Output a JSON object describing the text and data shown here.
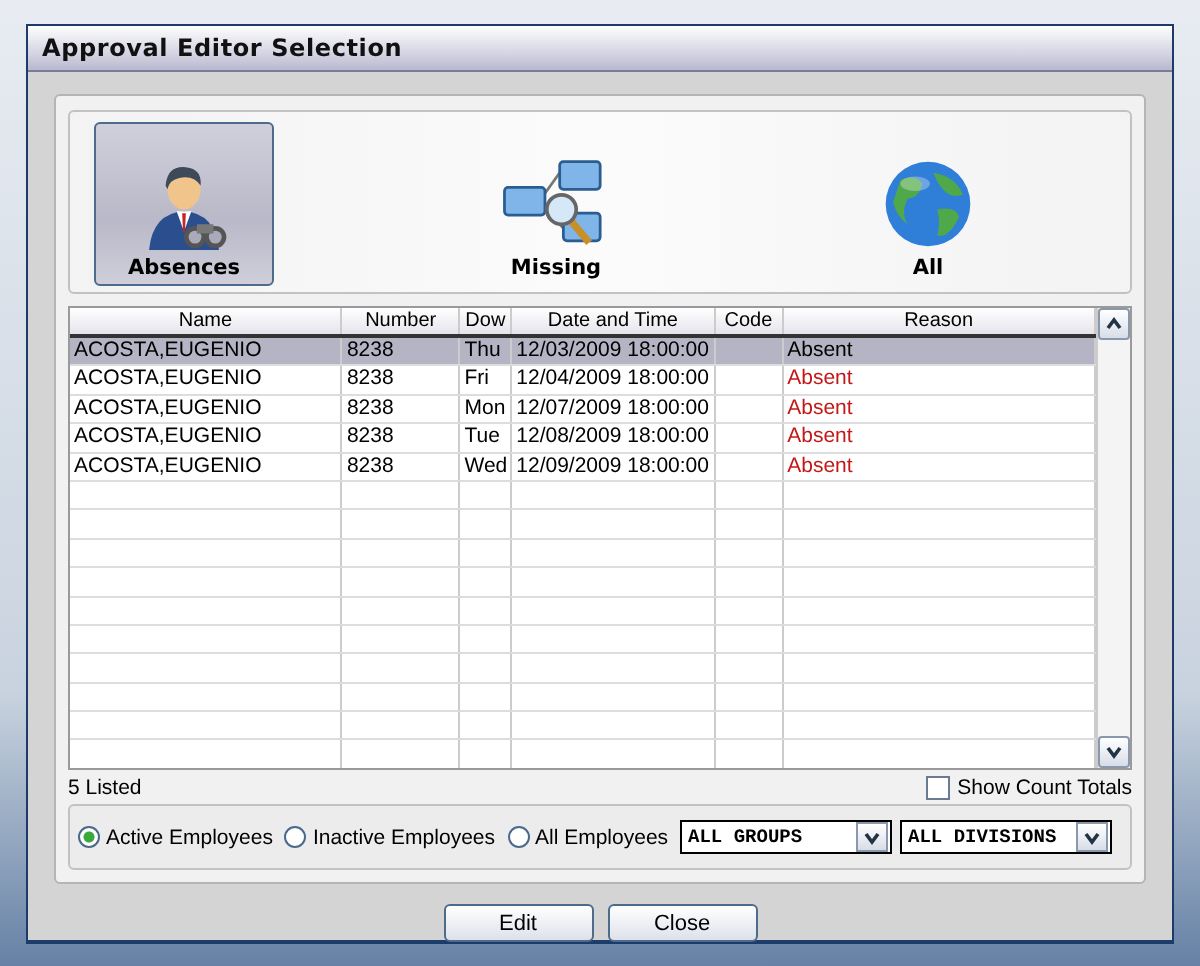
{
  "window": {
    "title": "Approval Editor Selection"
  },
  "modes": [
    {
      "label": "Absences",
      "selected": true
    },
    {
      "label": "Missing",
      "selected": false
    },
    {
      "label": "All",
      "selected": false
    }
  ],
  "table": {
    "columns": [
      "Name",
      "Number",
      "Dow",
      "Date and Time",
      "Code",
      "Reason"
    ],
    "rows": [
      {
        "cells": [
          "ACOSTA,EUGENIO",
          "8238",
          "Thu",
          "12/03/2009 18:00:00",
          "",
          "Absent"
        ],
        "selected": true
      },
      {
        "cells": [
          "ACOSTA,EUGENIO",
          "8238",
          "Fri",
          "12/04/2009 18:00:00",
          "",
          "Absent"
        ],
        "selected": false
      },
      {
        "cells": [
          "ACOSTA,EUGENIO",
          "8238",
          "Mon",
          "12/07/2009 18:00:00",
          "",
          "Absent"
        ],
        "selected": false
      },
      {
        "cells": [
          "ACOSTA,EUGENIO",
          "8238",
          "Tue",
          "12/08/2009 18:00:00",
          "",
          "Absent"
        ],
        "selected": false
      },
      {
        "cells": [
          "ACOSTA,EUGENIO",
          "8238",
          "Wed",
          "12/09/2009 18:00:00",
          "",
          "Absent"
        ],
        "selected": false
      }
    ]
  },
  "count_label": "5 Listed",
  "show_count_totals": {
    "label": "Show Count Totals",
    "checked": false
  },
  "employee_filter": [
    {
      "label": "Active Employees",
      "selected": true
    },
    {
      "label": "Inactive Employees",
      "selected": false
    },
    {
      "label": "All Employees",
      "selected": false
    }
  ],
  "dropdowns": [
    {
      "value": "ALL GROUPS"
    },
    {
      "value": "ALL DIVISIONS"
    }
  ],
  "buttons": [
    "Edit",
    "Close"
  ]
}
